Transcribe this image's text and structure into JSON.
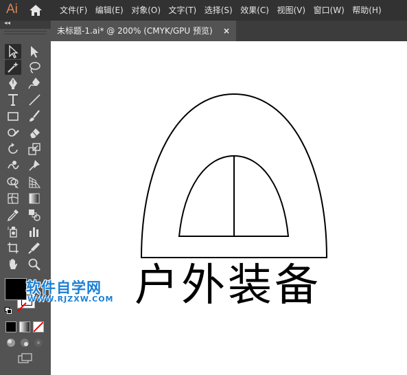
{
  "app": {
    "logo": "Ai"
  },
  "menu": [
    "文件(F)",
    "编辑(E)",
    "对象(O)",
    "文字(T)",
    "选择(S)",
    "效果(C)",
    "视图(V)",
    "窗口(W)",
    "帮助(H)"
  ],
  "panel": {
    "collapse_glyph": "◂◂"
  },
  "tab": {
    "label": "未标题-1.ai* @ 200% (CMYK/GPU 预览)",
    "close": "×"
  },
  "tools": [
    "selection-tool",
    "direct-selection-tool",
    "magic-wand-tool",
    "lasso-tool",
    "pen-tool",
    "curvature-tool",
    "type-tool",
    "line-segment-tool",
    "rectangle-tool",
    "paintbrush-tool",
    "shaper-tool",
    "eraser-tool",
    "rotate-tool",
    "scale-tool",
    "warp-tool",
    "free-transform-tool",
    "shape-builder-tool",
    "perspective-grid-tool",
    "mesh-tool",
    "gradient-tool",
    "eyedropper-tool",
    "blend-tool",
    "symbol-sprayer-tool",
    "column-graph-tool",
    "artboard-tool",
    "slice-tool",
    "hand-tool",
    "zoom-tool"
  ],
  "colors": {
    "fill": "#000000",
    "stroke": "#ffffff",
    "accent": "#d7865a",
    "watermark": "#1a7fd6"
  },
  "artwork": {
    "text": "户外装备"
  },
  "watermark": {
    "title": "软件自学网",
    "url": "WWW.RJZXW.COM"
  }
}
